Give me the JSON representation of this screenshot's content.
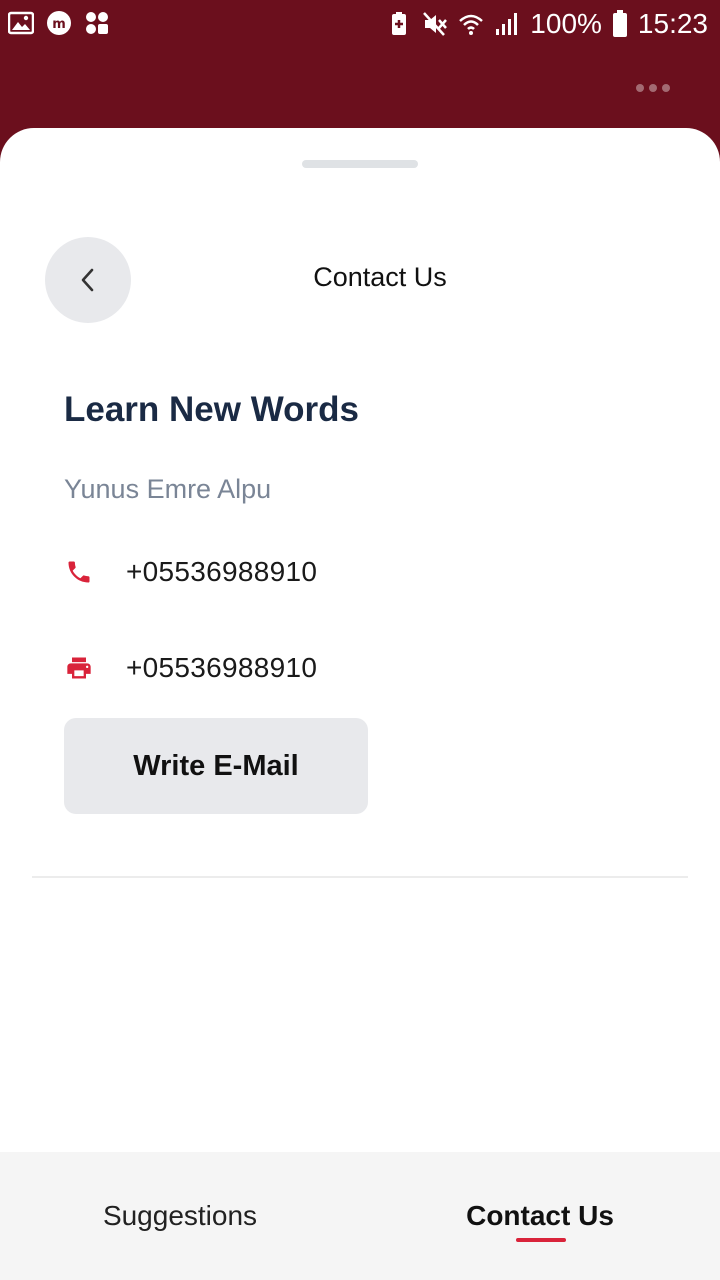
{
  "status_bar": {
    "battery": "100%",
    "time": "15:23",
    "icons": [
      "gallery-icon",
      "m-app-icon",
      "shortcut-icon",
      "battery-saver-icon",
      "mute-icon",
      "wifi-icon",
      "signal-icon",
      "battery-icon"
    ]
  },
  "header": {
    "title": "Contact Us",
    "back_icon": "chevron-left-icon",
    "more_icon": "more-dots-icon"
  },
  "contact": {
    "app_name": "Learn New Words",
    "developer": "Yunus Emre Alpu",
    "phone": "+05536988910",
    "fax": "+05536988910",
    "email_button": "Write E-Mail"
  },
  "tabs": {
    "suggestions": "Suggestions",
    "contact_us": "Contact Us",
    "active": "Contact Us"
  },
  "colors": {
    "brand": "#6b0f1d",
    "accent": "#d9233a",
    "title": "#1a2a44"
  }
}
